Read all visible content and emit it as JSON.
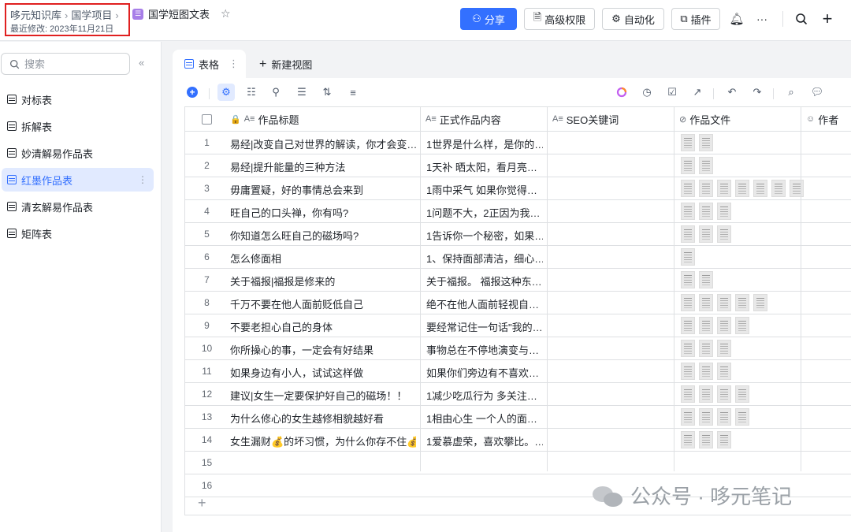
{
  "header": {
    "breadcrumb": [
      "哆元知识库",
      "国学项目"
    ],
    "breadcrumb_sep": "›",
    "last_modified": "最近修改: 2023年11月21日",
    "doc_title": "国学短图文表",
    "share_label": "分享",
    "permissions_label": "高级权限",
    "automation_label": "自动化",
    "plugins_label": "插件",
    "more_label": "···",
    "accent_color": "#3370ff"
  },
  "sidebar": {
    "search_placeholder": "搜索",
    "collapse_label": "«",
    "items": [
      {
        "label": "对标表"
      },
      {
        "label": "拆解表"
      },
      {
        "label": "妙清解易作品表"
      },
      {
        "label": "红墨作品表",
        "active": true
      },
      {
        "label": "清玄解易作品表"
      },
      {
        "label": "矩阵表"
      }
    ],
    "more_label": "⋮"
  },
  "view": {
    "tab_label": "表格",
    "tab_more": "⋮",
    "new_view_label": "新建视图",
    "new_view_plus": "+"
  },
  "table": {
    "columns": [
      "作品标题",
      "正式作品内容",
      "SEO关键词",
      "作品文件",
      "作者"
    ],
    "field_type_text": "A≡",
    "field_type_attachment": "⊘",
    "field_type_person": "☺",
    "lock_icon": "🔒",
    "rows": [
      {
        "num": "1",
        "title": "易经|改变自己对世界的解读，你才会变…",
        "content": "1世界是什么样，是你的…",
        "files": 2
      },
      {
        "num": "2",
        "title": "易经|提升能量的三种方法",
        "content": "1天补 晒太阳，看月亮…",
        "files": 2
      },
      {
        "num": "3",
        "title": "毋庸置疑，好的事情总会来到",
        "content": "1雨中采气 如果你觉得…",
        "files": 7
      },
      {
        "num": "4",
        "title": "旺自己的口头禅，你有吗?",
        "content": "1问题不大，2正因为我…",
        "files": 3
      },
      {
        "num": "5",
        "title": "你知道怎么旺自己的磁场吗?",
        "content": "1告诉你一个秘密，如果…",
        "files": 3
      },
      {
        "num": "6",
        "title": "怎么修面相",
        "content": "1、保持面部清洁，细心…",
        "files": 1
      },
      {
        "num": "7",
        "title": "关于福报|福报是修来的",
        "content": "关于福报。 福报这种东…",
        "files": 2
      },
      {
        "num": "8",
        "title": "千万不要在他人面前贬低自己",
        "content": "绝不在他人面前轻视自…",
        "files": 5
      },
      {
        "num": "9",
        "title": "不要老担心自己的身体",
        "content": "要经常记住一句话\"我的…",
        "files": 4
      },
      {
        "num": "10",
        "title": "你所操心的事，一定会有好结果",
        "content": "事物总在不停地演变与…",
        "files": 3
      },
      {
        "num": "11",
        "title": "如果身边有小人，试试这样做",
        "content": "如果你们旁边有不喜欢…",
        "files": 3
      },
      {
        "num": "12",
        "title": "建议|女生一定要保护好自己的磁场！！",
        "content": "1减少吃瓜行为 多关注…",
        "files": 4
      },
      {
        "num": "13",
        "title": "为什么修心的女生越修相貌越好看",
        "content": "1相由心生 一个人的面…",
        "files": 4
      },
      {
        "num": "14",
        "title": "女生漏财💰的坏习惯，为什么你存不住💰",
        "content": "1爱慕虚荣，喜欢攀比。…",
        "files": 3
      },
      {
        "num": "15",
        "title": "",
        "content": "",
        "files": 0
      },
      {
        "num": "16",
        "title": "",
        "content": "",
        "files": 0
      }
    ],
    "add_row_label": "+"
  },
  "watermark": "公众号 · 哆元笔记"
}
